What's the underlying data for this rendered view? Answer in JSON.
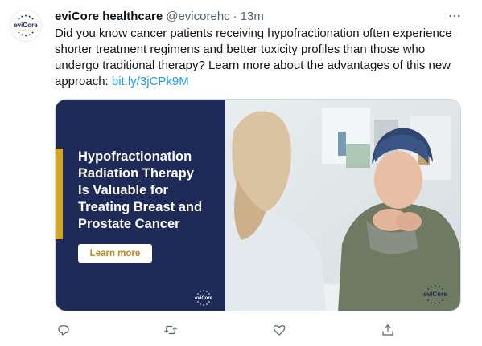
{
  "tweet": {
    "author": {
      "display_name": "eviCore healthcare",
      "handle": "@evicorehc",
      "separator": "·",
      "timestamp": "13m",
      "avatar_logo_text": "eviCore",
      "avatar_logo_subtext": "healthcare"
    },
    "more_icon": "more-horizontal-icon",
    "text": "Did you know cancer patients receiving hypofractionation often experience shorter treatment regimens and better toxicity profiles than those who undergo traditional therapy? Learn more about the advantages of this new approach: ",
    "link": "bit.ly/3jCPk9M",
    "card": {
      "headline_lines": [
        "Hypofractionation",
        "Radiation Therapy",
        "Is Valuable for",
        "Treating Breast and",
        "Prostate Cancer"
      ],
      "cta_label": "Learn more",
      "logo_text": "eviCore",
      "colors": {
        "panel": "#1e2a57",
        "accent": "#d4a628",
        "cta_text": "#c08a16"
      }
    },
    "actions": [
      {
        "name": "reply",
        "icon": "reply-icon"
      },
      {
        "name": "retweet",
        "icon": "retweet-icon"
      },
      {
        "name": "like",
        "icon": "heart-icon"
      },
      {
        "name": "share",
        "icon": "share-icon"
      }
    ],
    "colors": {
      "link": "#1d9bf0",
      "secondary_text": "#536471",
      "primary_text": "#0f1419"
    }
  }
}
